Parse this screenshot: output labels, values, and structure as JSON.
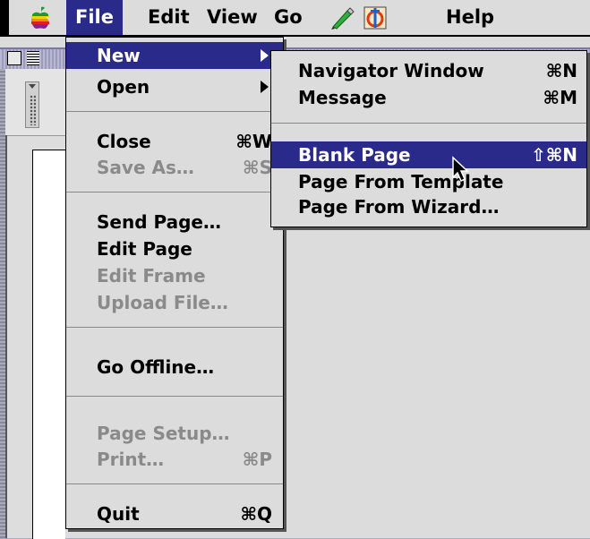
{
  "menubar": {
    "items": [
      {
        "label": "File"
      },
      {
        "label": "Edit"
      },
      {
        "label": "View"
      },
      {
        "label": "Go"
      },
      {
        "label": "Help"
      }
    ],
    "icons": [
      "apple-icon",
      "composer-pen-icon",
      "component-bar-icon"
    ]
  },
  "file_menu": {
    "items": [
      {
        "label": "New",
        "shortcut": ""
      },
      {
        "label": "Open",
        "shortcut": ""
      },
      {
        "label": "Close",
        "shortcut": "⌘W"
      },
      {
        "label": "Save As…",
        "shortcut": "⌘S"
      },
      {
        "label": "Send Page…",
        "shortcut": ""
      },
      {
        "label": "Edit Page",
        "shortcut": ""
      },
      {
        "label": "Edit Frame",
        "shortcut": ""
      },
      {
        "label": "Upload File…",
        "shortcut": ""
      },
      {
        "label": "Go Offline…",
        "shortcut": ""
      },
      {
        "label": "Page Setup…",
        "shortcut": ""
      },
      {
        "label": "Print…",
        "shortcut": "⌘P"
      },
      {
        "label": "Quit",
        "shortcut": "⌘Q"
      }
    ]
  },
  "new_submenu": {
    "items": [
      {
        "label": "Navigator Window",
        "shortcut": "⌘N"
      },
      {
        "label": "Message",
        "shortcut": "⌘M"
      },
      {
        "label": "Blank Page",
        "shortcut": "⇧⌘N"
      },
      {
        "label": "Page From Template",
        "shortcut": ""
      },
      {
        "label": "Page From Wizard…",
        "shortcut": ""
      }
    ]
  },
  "colors": {
    "highlight": "#2a2a8a",
    "menu_bg": "#dcdcdc",
    "disabled_text": "#8a8a8a",
    "desktop": "#a8a8c0"
  }
}
